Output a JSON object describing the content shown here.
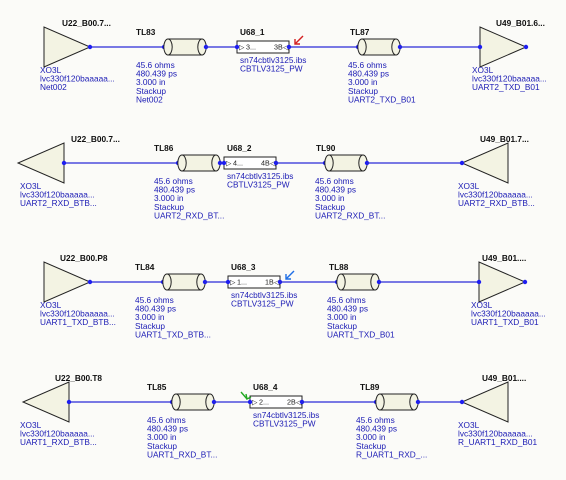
{
  "theme": {
    "background": "#fbfbf8",
    "signal_color": "#2a2ad8",
    "label_color": "#1a1ab4",
    "header_color": "#101010",
    "component_fill": "#f3f3e3",
    "buffer_box_fill": "#ffffff",
    "marker_red": "#d42020",
    "marker_blue": "#1e6ee6",
    "marker_green": "#22a822"
  },
  "channels": [
    {
      "left_driver": {
        "ref": "U22_B00.7...",
        "lines": [
          "XO3L",
          "lvc330f120baaaaa...",
          "Net002"
        ]
      },
      "tline_1": {
        "ref": "TL83",
        "lines": [
          "45.6 ohms",
          "480.439 ps",
          "3.000 in",
          "Stackup",
          "Net002"
        ]
      },
      "buffer": {
        "ref": "U68_1",
        "pin_in": "3...",
        "pin_out": "3B",
        "lines": [
          "sn74cbtlv3125.ibs",
          "CBTLV3125_PW"
        ],
        "marker": "red"
      },
      "tline_2": {
        "ref": "TL87",
        "lines": [
          "45.6 ohms",
          "480.439 ps",
          "3.000 in",
          "Stackup",
          "UART2_TXD_B01"
        ]
      },
      "right_driver": {
        "ref": "U49_B01.6...",
        "lines": [
          "XO3L",
          "lvc330f120baaaaa...",
          "UART2_TXD_B01"
        ]
      }
    },
    {
      "left_driver": {
        "ref": "U22_B00.7...",
        "lines": [
          "XO3L",
          "lvc330f120baaaaa...",
          "UART2_RXD_BTB..."
        ]
      },
      "tline_1": {
        "ref": "TL86",
        "lines": [
          "45.6 ohms",
          "480.439 ps",
          "3.000 in",
          "Stackup",
          "UART2_RXD_BT..."
        ]
      },
      "buffer": {
        "ref": "U68_2",
        "pin_in": "4...",
        "pin_out": "4B",
        "lines": [
          "sn74cbtlv3125.ibs",
          "CBTLV3125_PW"
        ],
        "marker": "none"
      },
      "tline_2": {
        "ref": "TL90",
        "lines": [
          "45.6 ohms",
          "480.439 ps",
          "3.000 in",
          "Stackup",
          "UART2_RXD_BT..."
        ]
      },
      "right_driver": {
        "ref": "U49_B01.7...",
        "lines": [
          "XO3L",
          "lvc330f120baaaaa...",
          "UART2_RXD_BTB..."
        ]
      }
    },
    {
      "left_driver": {
        "ref": "U22_B00.P8",
        "lines": [
          "XO3L",
          "lvc330f120baaaaa...",
          "UART1_TXD_BTB..."
        ]
      },
      "tline_1": {
        "ref": "TL84",
        "lines": [
          "45.6 ohms",
          "480.439 ps",
          "3.000 in",
          "Stackup",
          "UART1_TXD_BTB..."
        ]
      },
      "buffer": {
        "ref": "U68_3",
        "pin_in": "1...",
        "pin_out": "1B",
        "lines": [
          "sn74cbtlv3125.ibs",
          "CBTLV3125_PW"
        ],
        "marker": "blue"
      },
      "tline_2": {
        "ref": "TL88",
        "lines": [
          "45.6 ohms",
          "480.439 ps",
          "3.000 in",
          "Stackup",
          "UART1_TXD_B01"
        ]
      },
      "right_driver": {
        "ref": "U49_B01....",
        "lines": [
          "XO3L",
          "lvc330f120baaaaa...",
          "UART1_TXD_B01"
        ]
      }
    },
    {
      "left_driver": {
        "ref": "U22_B00.T8",
        "lines": [
          "XO3L",
          "lvc330f120baaaaa...",
          "UART1_RXD_BTB..."
        ]
      },
      "tline_1": {
        "ref": "TL85",
        "lines": [
          "45.6 ohms",
          "480.439 ps",
          "3.000 in",
          "Stackup",
          "UART1_RXD_BT..."
        ]
      },
      "buffer": {
        "ref": "U68_4",
        "pin_in": "2...",
        "pin_out": "2B",
        "lines": [
          "sn74cbtlv3125.ibs",
          "CBTLV3125_PW"
        ],
        "marker": "green"
      },
      "tline_2": {
        "ref": "TL89",
        "lines": [
          "45.6 ohms",
          "480.439 ps",
          "3.000 in",
          "Stackup",
          "R_UART1_RXD_..."
        ]
      },
      "right_driver": {
        "ref": "U49_B01....",
        "lines": [
          "XO3L",
          "lvc330f120baaaaa...",
          "R_UART1_RXD_B01"
        ]
      }
    }
  ]
}
